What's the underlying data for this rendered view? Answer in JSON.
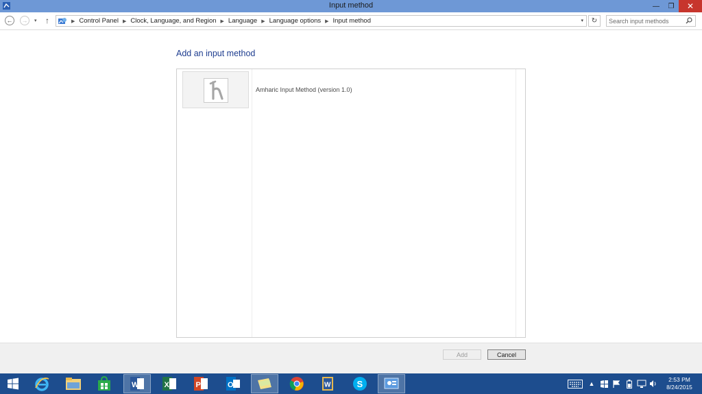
{
  "window": {
    "title": "Input method",
    "minimize_glyph": "—",
    "maximize_glyph": "❐",
    "close_glyph": "✕"
  },
  "nav": {
    "back_glyph": "←",
    "forward_glyph": "→",
    "recent_glyph": "▾",
    "up_glyph": "↑",
    "refresh_glyph": "↻",
    "dropdown_glyph": "▾",
    "breadcrumb": [
      "Control Panel",
      "Clock, Language, and Region",
      "Language",
      "Language options",
      "Input method"
    ],
    "search_placeholder": "Search input methods"
  },
  "main": {
    "heading": "Add an input method",
    "input_methods": [
      {
        "name": "Amharic Input Method (version 1.0)",
        "icon": "amharic-input-icon"
      }
    ]
  },
  "buttons": {
    "add_label": "Add",
    "cancel_label": "Cancel"
  },
  "taskbar": {
    "apps": [
      {
        "icon": "internet-explorer-icon"
      },
      {
        "icon": "file-explorer-icon"
      },
      {
        "icon": "store-icon"
      },
      {
        "icon": "word-icon"
      },
      {
        "icon": "excel-icon"
      },
      {
        "icon": "powerpoint-icon"
      },
      {
        "icon": "outlook-icon"
      },
      {
        "icon": "notes-icon"
      },
      {
        "icon": "chrome-icon"
      },
      {
        "icon": "word-doc-icon"
      },
      {
        "icon": "skype-icon"
      },
      {
        "icon": "control-panel-icon"
      }
    ],
    "clock_time": "2:53 PM",
    "clock_date": "8/24/2015"
  },
  "colors": {
    "titlebar": "#6e98d6",
    "close_button": "#c7352d",
    "heading": "#1e3d8f",
    "taskbar": "#1d4d8e"
  }
}
